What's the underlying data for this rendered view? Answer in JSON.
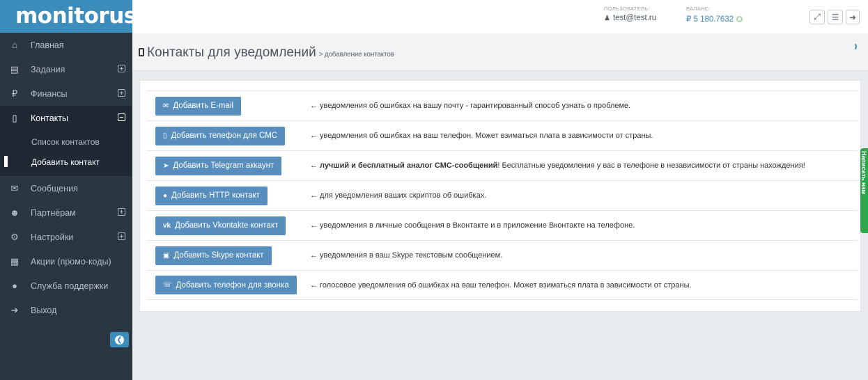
{
  "brand": {
    "name": "monitorus"
  },
  "sidebar": {
    "items": [
      {
        "label": "Главная",
        "icon": "home-icon"
      },
      {
        "label": "Задания",
        "icon": "tasks-icon",
        "expand": "plus"
      },
      {
        "label": "Финансы",
        "icon": "ruble-icon",
        "expand": "plus"
      },
      {
        "label": "Контакты",
        "icon": "phone-icon",
        "expand": "minus",
        "active": true
      },
      {
        "label": "Сообщения",
        "icon": "envelope-icon"
      },
      {
        "label": "Партнёрам",
        "icon": "users-icon",
        "expand": "plus"
      },
      {
        "label": "Настройки",
        "icon": "gear-icon",
        "expand": "plus"
      },
      {
        "label": "Акции (промо-коды)",
        "icon": "gift-icon"
      },
      {
        "label": "Служба поддержки",
        "icon": "comments-icon"
      },
      {
        "label": "Выход",
        "icon": "logout-icon"
      }
    ],
    "submenu": [
      {
        "label": "Список контактов"
      },
      {
        "label": "Добавить контакт",
        "current": true
      }
    ]
  },
  "topbar": {
    "user_label": "ПОЛЬЗОВАТЕЛЬ:",
    "user_value": "test@test.ru",
    "balance_label": "БАЛАНС:",
    "balance_value": "₽ 5 180.7632"
  },
  "page": {
    "title": "Контакты для уведомлений",
    "subtitle": "> добавление контактов"
  },
  "rows": [
    {
      "button": "Добавить E-mail",
      "icon": "envelope-icon",
      "desc": "← уведомления об ошибках на вашу почту - гарантированный способ узнать о проблеме."
    },
    {
      "button": "Добавить телефон для СМС",
      "icon": "mobile-icon",
      "desc": "← уведомления об ошибках на ваш телефон. Может взиматься плата в зависимости от страны."
    },
    {
      "button": "Добавить Telegram аккаунт",
      "icon": "telegram-icon",
      "desc_bold": "← лучший и бесплатный аналог СМС-сообщений",
      "desc": "! Бесплатные уведомления у вас в телефоне в независимости от страны нахождения!"
    },
    {
      "button": "Добавить HTTP контакт",
      "icon": "globe-icon",
      "desc": "← для уведомления ваших скриптов об ошибках."
    },
    {
      "button": "Добавить Vkontakte контакт",
      "icon": "vk-icon",
      "desc": "← уведомления в личные сообщения в Вконтакте и в приложение Вконтакте на телефоне."
    },
    {
      "button": "Добавить Skype контакт",
      "icon": "skype-icon",
      "desc": "← уведомления в ваш Skype текстовым сообщением."
    },
    {
      "button": "Добавить телефон для звонка",
      "icon": "phone-square-icon",
      "desc": "← голосовое уведомления об ошибках на ваш телефон. Может взиматься плата в зависимости от страны."
    }
  ],
  "right_tab": {
    "label": "Написать нам"
  },
  "colors": {
    "sidebar": "#2b3643",
    "logo_bg": "#3c8dbc",
    "button": "#578ebe",
    "right_tab": "#2ea64a"
  }
}
